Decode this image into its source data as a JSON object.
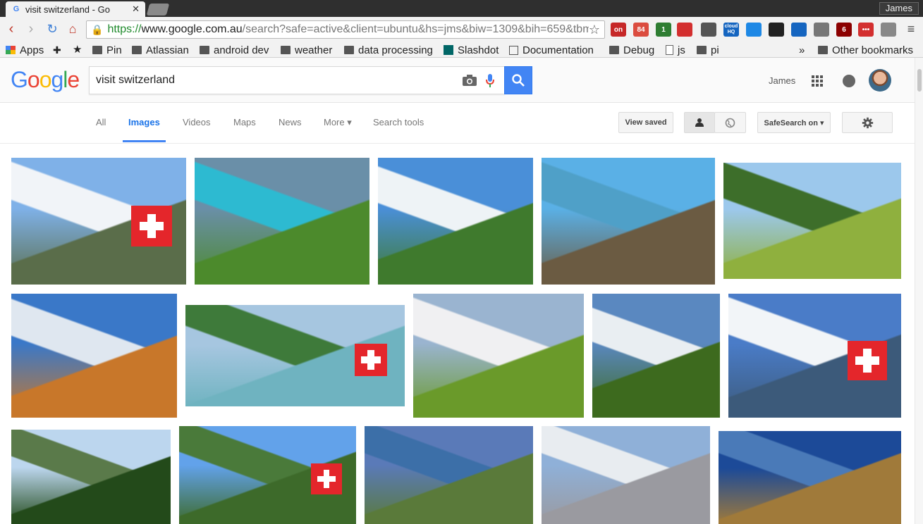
{
  "browser": {
    "tab_title": "visit switzerland - Go",
    "tab_close": "✕",
    "user": "James",
    "url_scheme": "https://",
    "url_host": "www.google.com.au",
    "url_path": "/search?safe=active&client=ubuntu&hs=jms&biw=1309&bih=659&tbm",
    "extensions": [
      {
        "name": "on-badge",
        "badge": "on",
        "color": "#c62828"
      },
      {
        "name": "todoist-badge",
        "badge": "84",
        "color": "#db4c3f"
      },
      {
        "name": "green-badge",
        "badge": "1",
        "color": "#2e7d32"
      },
      {
        "name": "plus-cross",
        "badge": "",
        "color": "#d32f2f"
      },
      {
        "name": "cast",
        "badge": "",
        "color": "#555555"
      },
      {
        "name": "cloud-hq",
        "badge": "cloud HQ",
        "color": "#1565c0"
      },
      {
        "name": "network",
        "badge": "",
        "color": "#1e88e5"
      },
      {
        "name": "terminal",
        "badge": "",
        "color": "#222222"
      },
      {
        "name": "vimium",
        "badge": "",
        "color": "#1565c0"
      },
      {
        "name": "screenshot",
        "badge": "",
        "color": "#777777"
      },
      {
        "name": "ublock",
        "badge": "6",
        "color": "#8b0000"
      },
      {
        "name": "lastpass",
        "badge": "•••",
        "color": "#d32f2f"
      },
      {
        "name": "folder-sync",
        "badge": "",
        "color": "#888888"
      }
    ]
  },
  "bookmarks": [
    {
      "label": "Apps",
      "icon": "apps-icon"
    },
    {
      "label": "",
      "icon": "puzzle-icon"
    },
    {
      "label": "",
      "icon": "star-icon"
    },
    {
      "label": "Pin",
      "icon": "folder-icon"
    },
    {
      "label": "Atlassian",
      "icon": "folder-icon"
    },
    {
      "label": "android dev",
      "icon": "folder-icon"
    },
    {
      "label": "weather",
      "icon": "folder-icon"
    },
    {
      "label": "data processing",
      "icon": "folder-icon"
    },
    {
      "label": "Slashdot",
      "icon": "slashdot-icon"
    },
    {
      "label": "Documentation",
      "icon": "doc-icon"
    },
    {
      "label": "Debug",
      "icon": "folder-icon"
    },
    {
      "label": "js",
      "icon": "page-icon"
    },
    {
      "label": "pi",
      "icon": "folder-icon"
    },
    {
      "label": "»",
      "icon": ""
    },
    {
      "label": "Other bookmarks",
      "icon": "folder-icon"
    }
  ],
  "google": {
    "logo": "Google",
    "query": "visit switzerland",
    "user": "James"
  },
  "nav": {
    "tabs": [
      "All",
      "Images",
      "Videos",
      "Maps",
      "News",
      "More ▾",
      "Search tools"
    ],
    "active": "Images",
    "view_saved": "View saved",
    "safesearch": "SafeSearch on ▾"
  },
  "images": [
    {
      "name": "matterhorn-flag",
      "colors": [
        "#7fb1e8",
        "#f1f4f8",
        "#5a6d4a"
      ],
      "flag": true
    },
    {
      "name": "lake-castle",
      "colors": [
        "#6a8fa8",
        "#2dbad1",
        "#4c8a2c"
      ]
    },
    {
      "name": "eiger-peaks",
      "colors": [
        "#4a8fd8",
        "#eef3f6",
        "#3f7a2d"
      ]
    },
    {
      "name": "lake-lucerne-cable",
      "colors": [
        "#5ab0e6",
        "#4fa0c8",
        "#6b5b42"
      ]
    },
    {
      "name": "valley-village",
      "colors": [
        "#9cc8ec",
        "#3d6e2a",
        "#8fb03e"
      ]
    },
    {
      "name": "zermatt-night",
      "colors": [
        "#3a78c8",
        "#dfe7f0",
        "#c8772a"
      ]
    },
    {
      "name": "interlaken-river",
      "colors": [
        "#a6c6e0",
        "#3e7a3a",
        "#6fb3c0"
      ],
      "flag": true
    },
    {
      "name": "red-train-flowers",
      "colors": [
        "#9ab4d0",
        "#f0f0f2",
        "#6a9a2a"
      ]
    },
    {
      "name": "train-yellow-flowers",
      "colors": [
        "#5a88c0",
        "#e9eef2",
        "#3d6a1e"
      ]
    },
    {
      "name": "jungfrau-flag",
      "colors": [
        "#4a7cc8",
        "#f2f5f8",
        "#3c5a7a"
      ],
      "flag": true
    },
    {
      "name": "cable-car",
      "colors": [
        "#bcd6ee",
        "#5a7a4a",
        "#234a1a"
      ]
    },
    {
      "name": "flag-wave",
      "colors": [
        "#62a2ea",
        "#4a7a3a",
        "#3d6a2a"
      ],
      "flag": true
    },
    {
      "name": "spiez-castle",
      "colors": [
        "#5a7ab8",
        "#3c6fa8",
        "#5a7a3a"
      ]
    },
    {
      "name": "alpine-clouds",
      "colors": [
        "#8fb0d8",
        "#e8ecf0",
        "#9a9aa0"
      ]
    },
    {
      "name": "chillon-castle",
      "colors": [
        "#1c4a98",
        "#4a7ab8",
        "#a07a3a"
      ]
    }
  ]
}
